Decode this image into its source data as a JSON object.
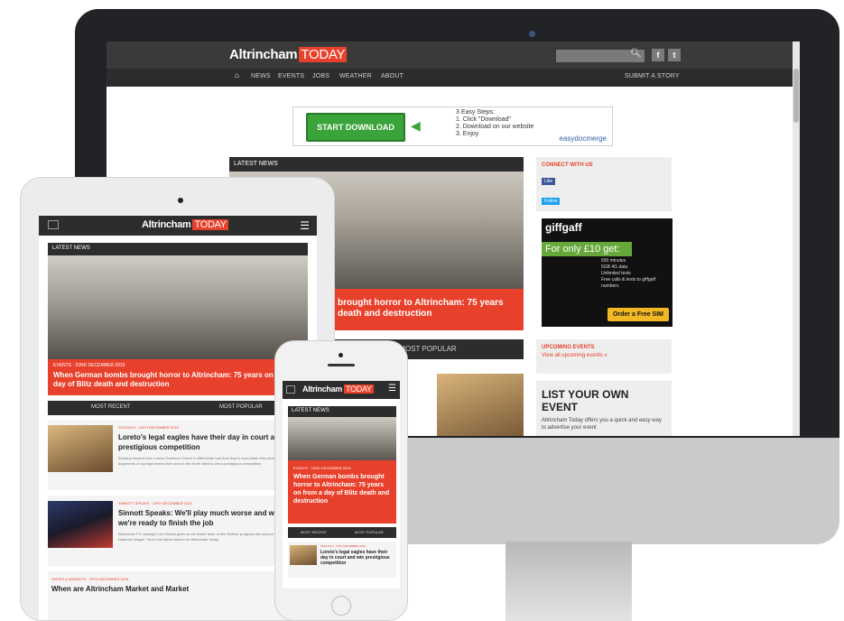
{
  "site": {
    "logo_main": "Altrincham",
    "logo_badge": "TODAY",
    "nav": [
      {
        "label": "NEWS"
      },
      {
        "label": "EVENTS"
      },
      {
        "label": "JOBS"
      },
      {
        "label": "WEATHER"
      },
      {
        "label": "ABOUT"
      }
    ],
    "submit_story": "SUBMIT A STORY",
    "social": {
      "facebook": "f",
      "twitter": "t"
    }
  },
  "ad": {
    "button": "START DOWNLOAD",
    "steps_title": "3 Easy Steps:",
    "step1": "1. Click \"Download\"",
    "step2": "2. Download on our website",
    "step3": "3. Enjoy",
    "brand": "easydocmerge"
  },
  "main": {
    "latest_news_label": "LATEST NEWS",
    "hero_headline": "brought horror to Altrincham: 75 years death and destruction",
    "most_popular": "MOST POPULAR"
  },
  "sidebar": {
    "connect": "CONNECT WITH US",
    "like": "Like",
    "follow": "Follow",
    "giffgaff_brand": "giffgaff",
    "giffgaff_offer": "For only £10 get:",
    "giffgaff_items": [
      "500 minutes",
      "5GB 4G data",
      "Unlimited texts",
      "Free calls & texts to giffgaff numbers"
    ],
    "giffgaff_cta": "Order a Free SIM",
    "upcoming_title": "UPCOMING EVENTS",
    "upcoming_link": "View all upcoming events »",
    "list_event_title": "LIST YOUR OWN EVENT",
    "list_event_text": "Altrincham Today offers you a quick and easy way to advertise your event"
  },
  "tablet": {
    "latest_news_label": "LATEST NEWS",
    "hero_date": "EVENTS · 22ND DECEMBER 2015",
    "hero_headline": "When German bombs brought horror to Altrincham: 75 years on from a day of Blitz death and destruction",
    "tab_recent": "MOST RECENT",
    "tab_popular": "MOST POPULAR",
    "articles": [
      {
        "meta": "SCHOOLS · 24TH DECEMBER 2015",
        "title": "Loreto's legal eagles have their day in court and win prestigious competition",
        "excerpt": "Budding lawyers from Loreto Grammar School in Altrincham had their day in court when they picked apart the arguments of top legal teams from across the North West to win a prestigious competition."
      },
      {
        "meta": "SINNOTT SPEAKS · 19TH DECEMBER 2015",
        "title": "Sinnott Speaks: We'll play much worse and win – but we're ready to finish the job",
        "excerpt": "Altrincham FC manager Lee Sinnott gives us the inside track on the Robins' progress this season in the Vanarama National League. Here's his latest column for Altrincham Today."
      },
      {
        "meta": "SHOPS & MARKETS · 19TH DECEMBER 2015",
        "title": "When are Altrincham Market and Market",
        "excerpt": ""
      }
    ]
  },
  "phone": {
    "latest_news_label": "LATEST NEWS",
    "hero_date": "EVENTS · 22ND DECEMBER 2015",
    "hero_headline": "When German bombs brought horror to Altrincham: 75 years on from a day of Blitz death and destruction",
    "tab_recent": "MOST RECENT",
    "tab_popular": "MOST POPULAR",
    "article_meta": "SCHOOLS · 24TH DECEMBER 2015",
    "article_title": "Loreto's legal eagles have their day in court and win prestigious competition"
  },
  "colors": {
    "brand_red": "#e8412b",
    "dark_bar": "#2d2d2d",
    "ad_green": "#3aa33a"
  }
}
